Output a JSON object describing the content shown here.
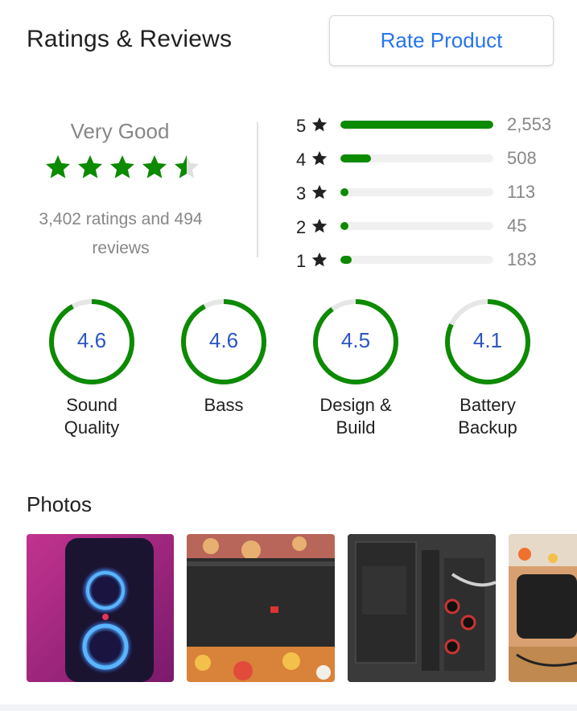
{
  "header": {
    "title": "Ratings & Reviews",
    "rate_button": "Rate Product"
  },
  "summary": {
    "verdict": "Very Good",
    "stars_filled": 4.5,
    "counts_line1": "3,402 ratings and 494",
    "counts_line2": "reviews"
  },
  "distribution": [
    {
      "label": "5",
      "count": "2,553",
      "value": 2553
    },
    {
      "label": "4",
      "count": "508",
      "value": 508
    },
    {
      "label": "3",
      "count": "113",
      "value": 113
    },
    {
      "label": "2",
      "count": "45",
      "value": 45
    },
    {
      "label": "1",
      "count": "183",
      "value": 183
    }
  ],
  "aspects": [
    {
      "value": "4.6",
      "score": 4.6,
      "label_line1": "Sound",
      "label_line2": "Quality"
    },
    {
      "value": "4.6",
      "score": 4.6,
      "label_line1": "Bass",
      "label_line2": ""
    },
    {
      "value": "4.5",
      "score": 4.5,
      "label_line1": "Design &",
      "label_line2": "Build"
    },
    {
      "value": "4.1",
      "score": 4.1,
      "label_line1": "Battery",
      "label_line2": "Backup"
    }
  ],
  "photos": {
    "title": "Photos"
  },
  "colors": {
    "accent": "#2874f0",
    "green": "#0c8a00",
    "ring_value": "#2a55c5",
    "muted": "#878787"
  },
  "icons": {
    "rating_star": "star-icon"
  }
}
